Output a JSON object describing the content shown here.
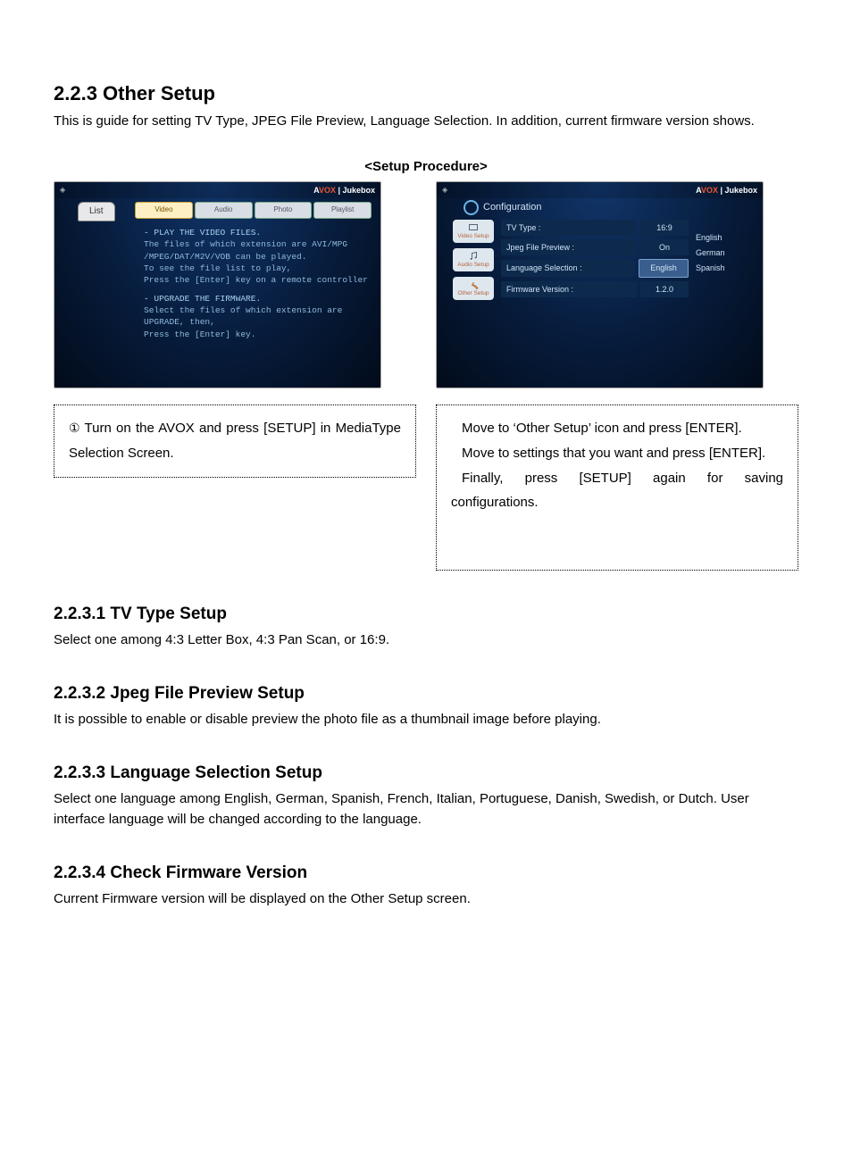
{
  "sec223": {
    "title": "2.2.3 Other Setup",
    "desc": "This is guide for setting TV Type, JPEG File Preview, Language Selection. In addition, current firmware version shows."
  },
  "setup_label": "<Setup Procedure>",
  "jukebox_brand_a": "A",
  "jukebox_brand_vox": "VOX",
  "jukebox_brand_jb": " | Jukebox",
  "left_shot": {
    "list_tab": "List",
    "tabs": {
      "video": "Video",
      "audio": "Audio",
      "photo": "Photo",
      "playlist": "Playlist"
    },
    "line1": "- PLAY THE VIDEO FILES.",
    "line2": "The files of which extension are AVI/MPG",
    "line3": "/MPEG/DAT/M2V/VOB can be played.",
    "line4": "To see the file list to play,",
    "line5": "Press the [Enter] key on a remote controller",
    "line6": "- UPGRADE THE FIRMWARE.",
    "line7": "Select the files of which extension are",
    "line8": "UPGRADE, then,",
    "line9": "Press the [Enter] key."
  },
  "right_shot": {
    "config": "Configuration",
    "side": {
      "video": "Video Setup",
      "audio": "Audio Setup",
      "other": "Other Setup"
    },
    "rows": {
      "tvtype_l": "TV Type :",
      "tvtype_v": "16:9",
      "jpeg_l": "Jpeg File Preview :",
      "jpeg_v": "On",
      "lang_l": "Language Selection :",
      "lang_v": "English",
      "fw_l": "Firmware Version :",
      "fw_v": "1.2.0"
    },
    "langs": {
      "en": "English",
      "de": "German",
      "es": "Spanish"
    }
  },
  "step1_num": "①",
  "step1": " Turn on the AVOX and press [SETUP] in MediaType Selection Screen.",
  "step2a": "Move to ‘Other Setup’ icon and press [ENTER].",
  "step2b": "Move to settings that you want and press [ENTER].",
  "step2c": "Finally, press [SETUP] again for saving configurations.",
  "s2231": {
    "h": "2.2.3.1 TV Type Setup",
    "p": "Select one among 4:3 Letter Box, 4:3 Pan Scan, or 16:9."
  },
  "s2232": {
    "h": "2.2.3.2 Jpeg File Preview Setup",
    "p": "It is possible to enable or disable preview the photo file as a thumbnail image before playing."
  },
  "s2233": {
    "h": "2.2.3.3 Language Selection Setup",
    "p": "Select one language among English, German, Spanish, French, Italian, Portuguese, Danish, Swedish, or Dutch. User interface language will be changed according to the language."
  },
  "s2234": {
    "h": "2.2.3.4 Check Firmware Version",
    "p": "Current Firmware version will be displayed on the Other Setup screen."
  }
}
